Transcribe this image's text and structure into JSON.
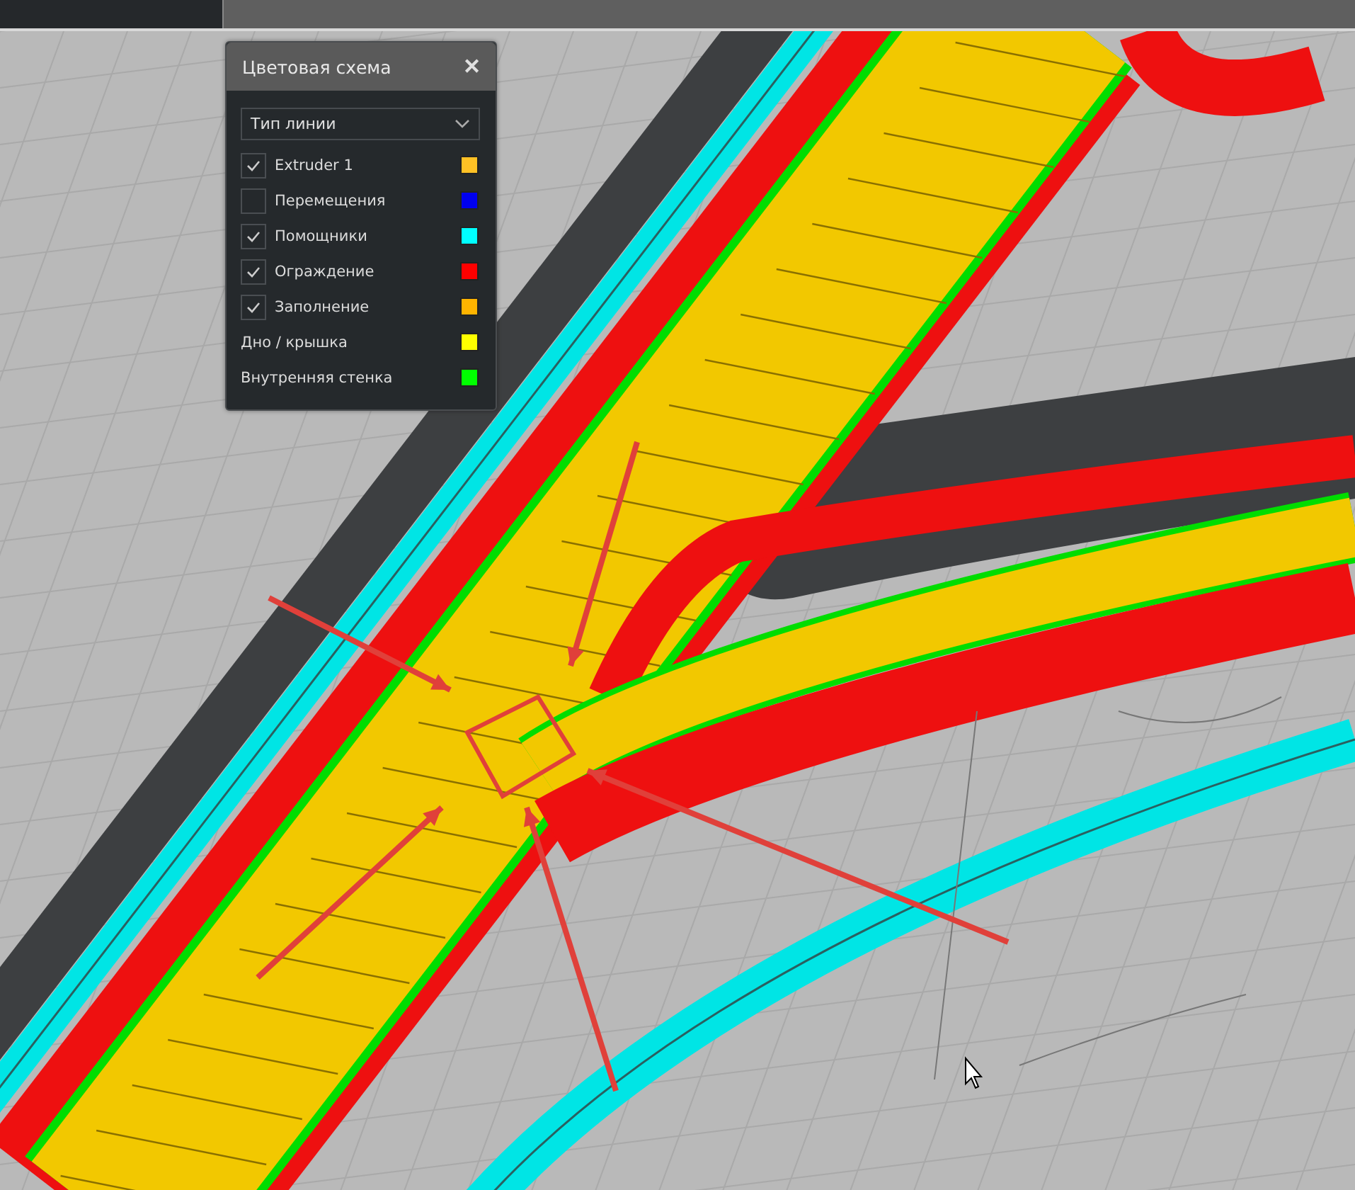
{
  "color_scheme_panel": {
    "title": "Цветовая схема",
    "close": "✕",
    "dropdown": {
      "value": "Тип линии"
    },
    "items": [
      {
        "kind": "checkbox",
        "label": "Extruder 1",
        "checked": true,
        "color": "#ffc125"
      },
      {
        "kind": "checkbox",
        "label": "Перемещения",
        "checked": false,
        "color": "#0000ee"
      },
      {
        "kind": "checkbox",
        "label": "Помощники",
        "checked": true,
        "color": "#00ffff"
      },
      {
        "kind": "checkbox",
        "label": "Ограждение",
        "checked": true,
        "color": "#ff0000"
      },
      {
        "kind": "checkbox",
        "label": "Заполнение",
        "checked": true,
        "color": "#ffb400"
      },
      {
        "kind": "plain",
        "label": "Дно / крышка",
        "color": "#ffff00"
      },
      {
        "kind": "plain",
        "label": "Внутренняя стенка",
        "color": "#00ff00"
      }
    ]
  }
}
